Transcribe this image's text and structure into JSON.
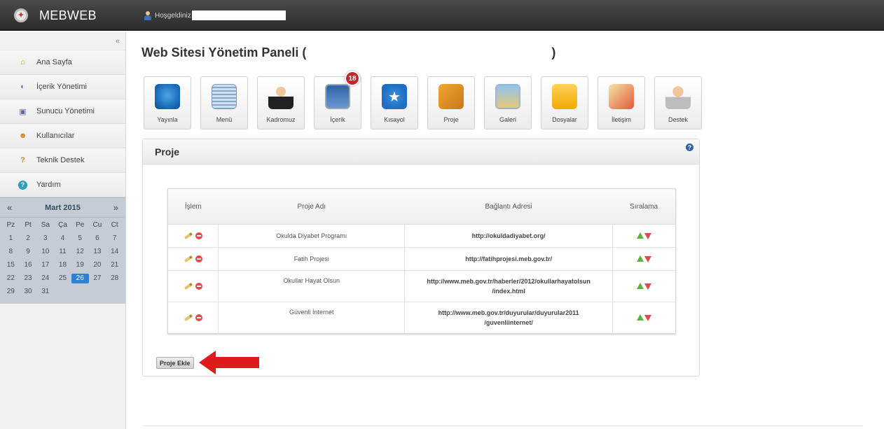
{
  "brand": {
    "title": "MEBWEB"
  },
  "header": {
    "welcome": "Hoşgeldiniz"
  },
  "sidebar": {
    "collapse": "«",
    "items": [
      {
        "label": "Ana Sayfa"
      },
      {
        "label": "İçerik Yönetimi"
      },
      {
        "label": "Sunucu Yönetimi"
      },
      {
        "label": "Kullanıcılar"
      },
      {
        "label": "Teknik Destek"
      },
      {
        "label": "Yardım"
      }
    ]
  },
  "calendar": {
    "month": "Mart 2015",
    "prev": "«",
    "next": "»",
    "days_of_week": [
      "Pz",
      "Pt",
      "Sa",
      "Ça",
      "Pe",
      "Cu",
      "Ct"
    ],
    "days": [
      "1",
      "2",
      "3",
      "4",
      "5",
      "6",
      "7",
      "8",
      "9",
      "10",
      "11",
      "12",
      "13",
      "14",
      "15",
      "16",
      "17",
      "18",
      "19",
      "20",
      "21",
      "22",
      "23",
      "24",
      "25",
      "26",
      "27",
      "28",
      "29",
      "30",
      "31"
    ],
    "today": "26"
  },
  "page": {
    "title": "Web Sitesi Yönetim Paneli (",
    "title_close": ")"
  },
  "toolbar": {
    "items": [
      {
        "label": "Yayınla",
        "icon": "globe-icon"
      },
      {
        "label": "Menü",
        "icon": "menu-list-icon"
      },
      {
        "label": "Kadromuz",
        "icon": "staff-icon"
      },
      {
        "label": "İçerik",
        "icon": "content-icon",
        "badge": "18"
      },
      {
        "label": "Kısayol",
        "icon": "star-icon"
      },
      {
        "label": "Proje",
        "icon": "project-icon"
      },
      {
        "label": "Galeri",
        "icon": "gallery-icon"
      },
      {
        "label": "Dosyalar",
        "icon": "folder-icon"
      },
      {
        "label": "İletişim",
        "icon": "contact-icon"
      },
      {
        "label": "Destek",
        "icon": "support-icon"
      }
    ]
  },
  "panel": {
    "title": "Proje",
    "help": "?",
    "table": {
      "headers": [
        "İşlem",
        "Proje Adı",
        "Bağlantı Adresi",
        "Sıralama"
      ],
      "rows": [
        {
          "name": "Okulda Diyabet Programı",
          "url": "http://okuldadiyabet.org/"
        },
        {
          "name": "Fatih Projesi",
          "url": "http://fatihprojesi.meb.gov.tr/"
        },
        {
          "name": "Okullar Hayat Olsun",
          "url_line1": "http://www.meb.gov.tr/haberler/2012/okullarhayatolsun",
          "url_line2": "/index.html"
        },
        {
          "name": "Güvenli İnternet",
          "url_line1": "http://www.meb.gov.tr/duyurular/duyurular2011",
          "url_line2": "/guvenliinternet/"
        }
      ]
    },
    "add_button": "Proje Ekle"
  },
  "colors": {
    "accent": "#2f7fd3",
    "badge": "#c1282d",
    "arrow": "#e01b1b"
  }
}
